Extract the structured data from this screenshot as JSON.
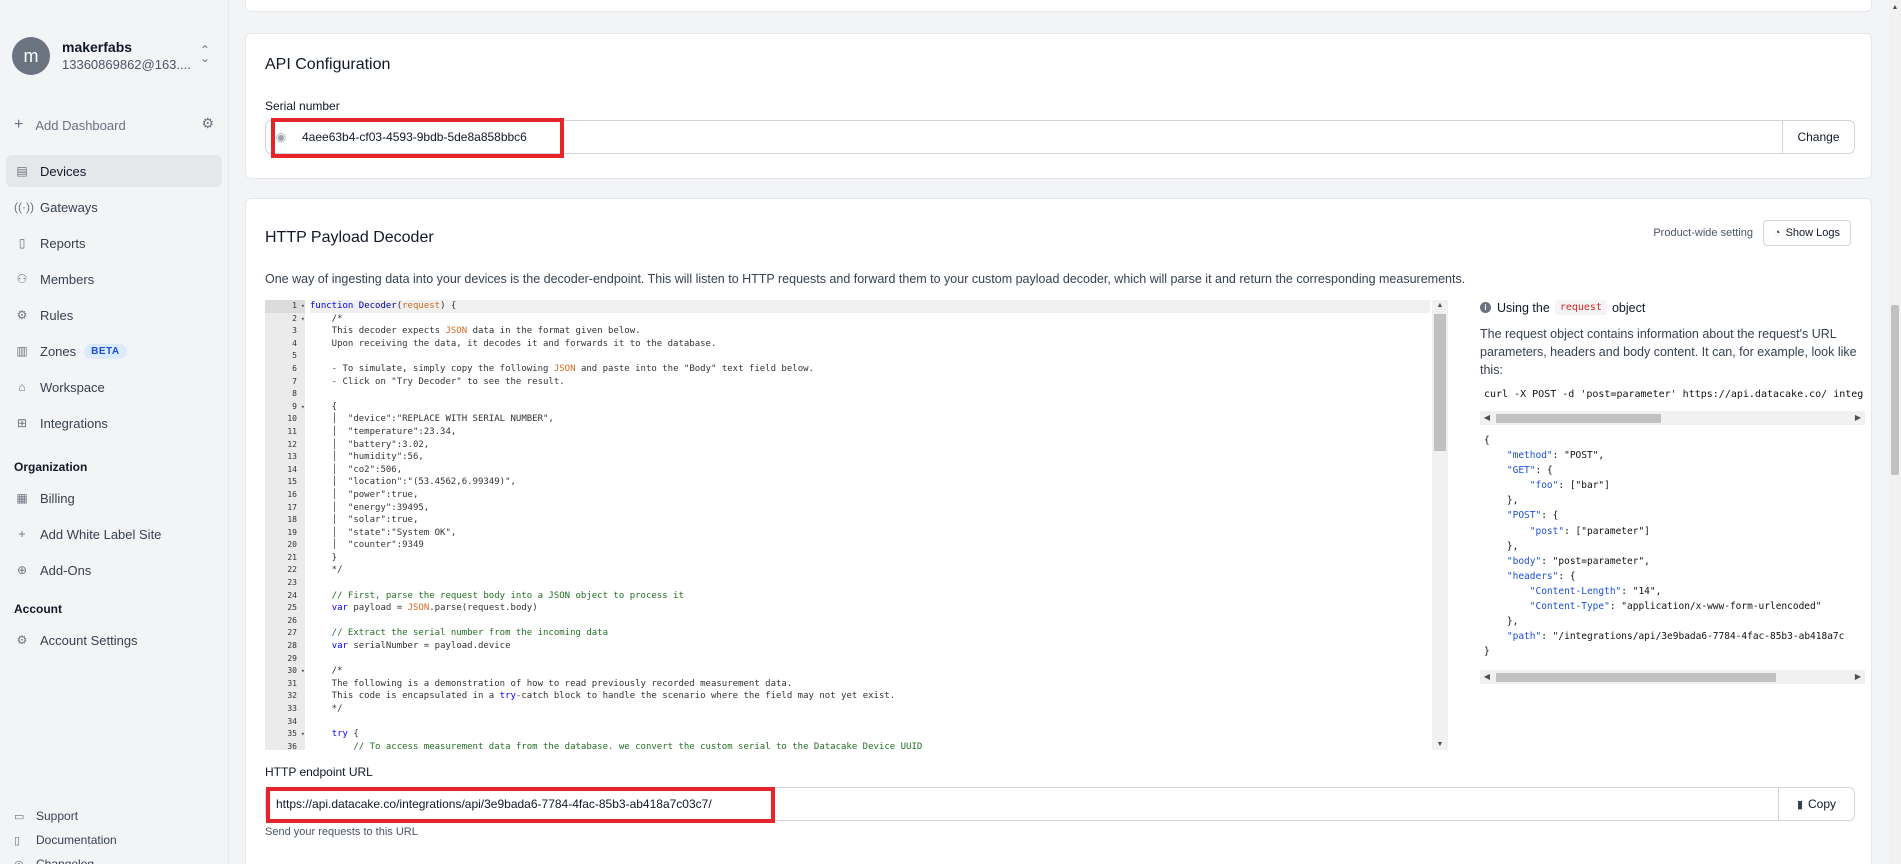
{
  "account": {
    "avatar_letter": "m",
    "name": "makerfabs",
    "email": "13360869862@163...."
  },
  "sidebar": {
    "add_dashboard": "Add Dashboard",
    "items": [
      {
        "label": "Devices",
        "icon": "devices-icon",
        "glyph": "▤",
        "active": true
      },
      {
        "label": "Gateways",
        "icon": "gateway-icon",
        "glyph": "((·))",
        "active": false
      },
      {
        "label": "Reports",
        "icon": "document-icon",
        "glyph": "▯",
        "active": false
      },
      {
        "label": "Members",
        "icon": "members-icon",
        "glyph": "⚇",
        "active": false
      },
      {
        "label": "Rules",
        "icon": "rules-icon",
        "glyph": "⚙",
        "active": false
      },
      {
        "label": "Zones",
        "icon": "map-icon",
        "glyph": "▥",
        "active": false,
        "badge": "BETA"
      },
      {
        "label": "Workspace",
        "icon": "home-icon",
        "glyph": "⌂",
        "active": false
      },
      {
        "label": "Integrations",
        "icon": "integrations-icon",
        "glyph": "⊞",
        "active": false
      }
    ],
    "organization_title": "Organization",
    "organization_items": [
      {
        "label": "Billing",
        "icon": "billing-icon",
        "glyph": "▦"
      },
      {
        "label": "Add White Label Site",
        "icon": "plus-icon",
        "glyph": "+"
      },
      {
        "label": "Add-Ons",
        "icon": "addons-icon",
        "glyph": "⊕"
      }
    ],
    "account_title": "Account",
    "account_items": [
      {
        "label": "Account Settings",
        "icon": "gear-icon",
        "glyph": "⚙"
      }
    ],
    "bottom_links": [
      {
        "label": "Support",
        "icon": "chat-icon",
        "glyph": "▭"
      },
      {
        "label": "Documentation",
        "icon": "book-icon",
        "glyph": "▯"
      },
      {
        "label": "Changelog",
        "icon": "megaphone-icon",
        "glyph": "◎"
      }
    ]
  },
  "api_config": {
    "title": "API Configuration",
    "serial_label": "Serial number",
    "serial_value": "4aee63b4-cf03-4593-9bdb-5de8a858bbc6",
    "change_label": "Change"
  },
  "http_decoder": {
    "title": "HTTP Payload Decoder",
    "product_wide": "Product-wide setting",
    "show_logs": "Show Logs",
    "description": "One way of ingesting data into your devices is the decoder-endpoint. This will listen to HTTP requests and forward them to your custom payload decoder, which will parse it and return the corresponding measurements.",
    "code_lines": [
      "function Decoder(request) {",
      "    /*",
      "    This decoder expects JSON data in the format given below.",
      "    Upon receiving the data, it decodes it and forwards it to the database.",
      "",
      "    - To simulate, simply copy the following JSON and paste into the \"Body\" text field below.",
      "    - Click on \"Try Decoder\" to see the result.",
      "",
      "    {",
      "    │  \"device\":\"REPLACE WITH SERIAL NUMBER\",",
      "    │  \"temperature\":23.34,",
      "    │  \"battery\":3.02,",
      "    │  \"humidity\":56,",
      "    │  \"co2\":506,",
      "    │  \"location\":\"(53.4562,6.99349)\",",
      "    │  \"power\":true,",
      "    │  \"energy\":39495,",
      "    │  \"solar\":true,",
      "    │  \"state\":\"System OK\",",
      "    │  \"counter\":9349",
      "    }",
      "    */",
      "",
      "    // First, parse the request body into a JSON object to process it",
      "    var payload = JSON.parse(request.body)",
      "",
      "    // Extract the serial number from the incoming data",
      "    var serialNumber = payload.device",
      "",
      "    /*",
      "    The following is a demonstration of how to read previously recorded measurement data.",
      "    This code is encapsulated in a try-catch block to handle the scenario where the field may not yet exist.",
      "    */",
      "",
      "    try {",
      "        // To access measurement data from the database. we convert the custom serial to the Datacake Device UUID"
    ],
    "fold_lines": [
      1,
      2,
      9,
      30,
      35
    ],
    "help_title_pre": "Using the",
    "help_code": "request",
    "help_title_post": "object",
    "help_text": "The request object contains information about the request's URL parameters, headers and body content. It can, for example, look like this:",
    "curl_line": "curl -X POST -d 'post=parameter' https://api.datacake.co/ integ",
    "json_lines": [
      "{",
      "    \"method\": \"POST\",",
      "    \"GET\": {",
      "        \"foo\": [\"bar\"]",
      "    },",
      "    \"POST\": {",
      "        \"post\": [\"parameter\"]",
      "    },",
      "    \"body\": \"post=parameter\",",
      "    \"headers\": {",
      "        \"Content-Length\": \"14\",",
      "        \"Content-Type\": \"application/x-www-form-urlencoded\"",
      "    },",
      "    \"path\": \"/integrations/api/3e9bada6-7784-4fac-85b3-ab418a7c",
      "}"
    ],
    "endpoint_label": "HTTP endpoint URL",
    "endpoint_value": "https://api.datacake.co/integrations/api/3e9bada6-7784-4fac-85b3-ab418a7c03c7/",
    "copy_label": "Copy",
    "endpoint_hint": "Send your requests to this URL"
  },
  "colors": {
    "highlight_red": "#e8242b",
    "beta_bg": "#dbeafe",
    "beta_text": "#1d4ed8"
  }
}
